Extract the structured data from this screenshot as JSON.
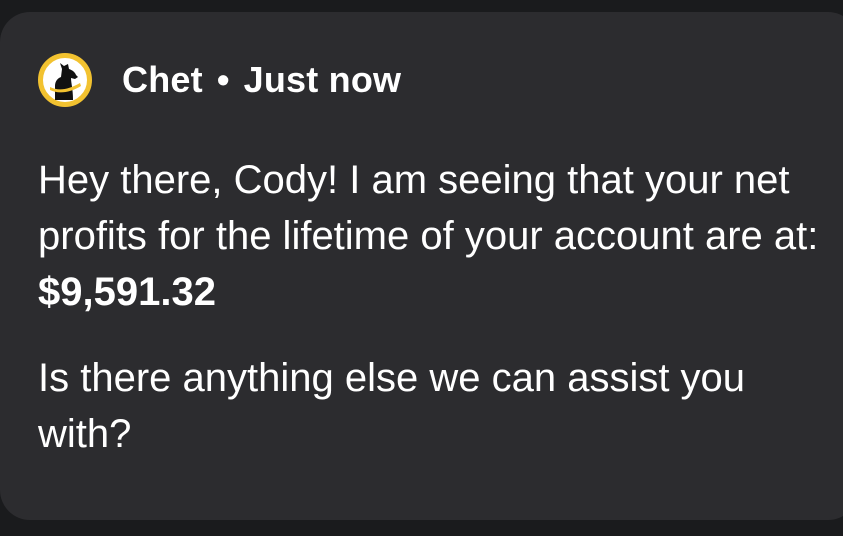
{
  "notification": {
    "sender": "Chet",
    "separator": "•",
    "time": "Just now",
    "avatar_icon": "dog-silhouette-logo",
    "accent_color": "#f2c230",
    "card_color": "#2c2c2f",
    "message": {
      "paragraph1_text": "Hey there, Cody! I am seeing that your net profits for the lifetime of your account are at: ",
      "amount": "$9,591.32",
      "paragraph2_text": "Is there anything else we can assist you with?"
    }
  }
}
